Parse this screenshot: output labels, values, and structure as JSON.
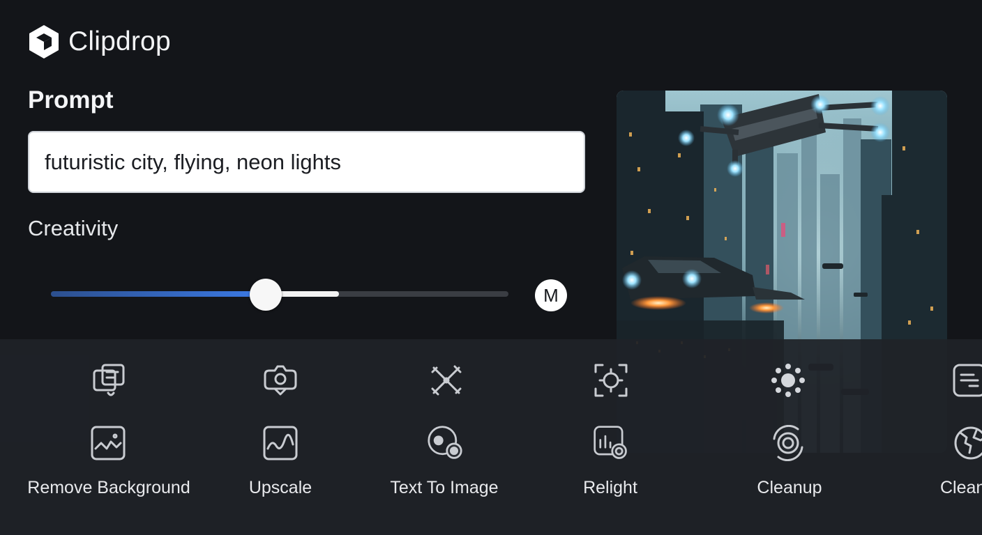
{
  "app": {
    "name": "Clipdrop"
  },
  "prompt": {
    "label": "Prompt",
    "value": "futuristic city, flying, neon lights"
  },
  "creativity": {
    "label": "Creativity",
    "level": 0.47,
    "size_badge": "M"
  },
  "tools": {
    "top_row_icons": [
      "image-edit-icon",
      "camera-icon",
      "crossed-wands-icon",
      "focus-frame-icon",
      "sun-burst-icon",
      "text-doc-icon"
    ],
    "bottom_row_icons": [
      "landscape-icon",
      "waveform-image-icon",
      "image-record-icon",
      "chart-badge-icon",
      "orbit-icon",
      "globe-icon"
    ],
    "labels": [
      "Remove Background",
      "Upscale",
      "Text To Image",
      "Relight",
      "Cleanup",
      "Clean"
    ]
  },
  "colors": {
    "background": "#131519",
    "toolbar": "#1f2228",
    "accent_blue": "#3b7ae6"
  }
}
